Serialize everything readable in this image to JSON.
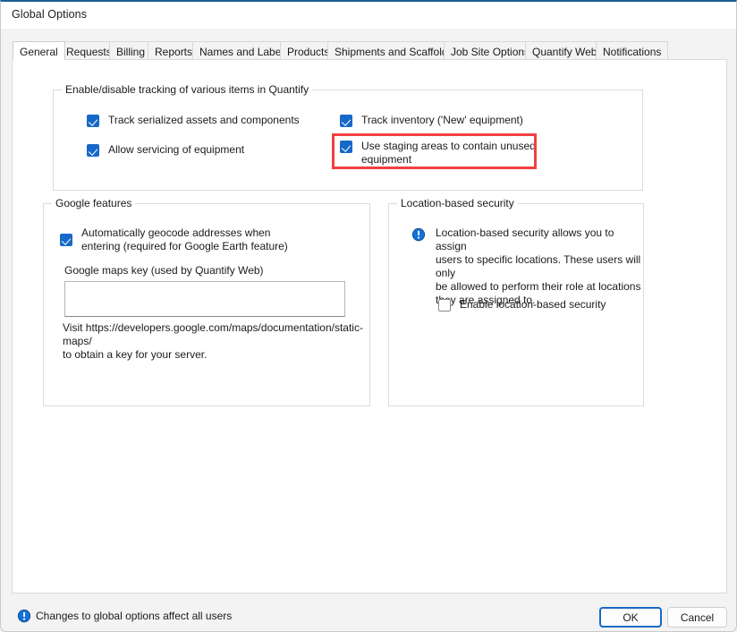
{
  "window": {
    "title": "Global Options"
  },
  "tabs": [
    {
      "label": "General",
      "selected": true
    },
    {
      "label": "Requests",
      "selected": false
    },
    {
      "label": "Billing",
      "selected": false
    },
    {
      "label": "Reports",
      "selected": false
    },
    {
      "label": "Names and Labels",
      "selected": false
    },
    {
      "label": "Products",
      "selected": false
    },
    {
      "label": "Shipments and Scaffolds",
      "selected": false
    },
    {
      "label": "Job Site Options",
      "selected": false
    },
    {
      "label": "Quantify Web",
      "selected": false
    },
    {
      "label": "Notifications",
      "selected": false
    }
  ],
  "tracking_group": {
    "title": "Enable/disable tracking of various items in Quantify",
    "checkboxes": [
      {
        "label": "Track serialized assets and components",
        "checked": true
      },
      {
        "label": "Allow servicing of equipment",
        "checked": true
      },
      {
        "label": "Track inventory ('New' equipment)",
        "checked": true
      },
      {
        "label": "Use staging areas to contain unused\nequipment",
        "checked": true,
        "highlighted": true
      }
    ]
  },
  "google_group": {
    "title": "Google features",
    "geocode_checkbox": {
      "label": "Automatically geocode addresses when\nentering (required for Google Earth feature)",
      "checked": true
    },
    "maps_key_label": "Google maps key (used by Quantify Web)",
    "maps_key_value": "",
    "maps_key_placeholder": "",
    "help_text": "Visit https://developers.google.com/maps/documentation/static-maps/\nto obtain a key for your server."
  },
  "location_group": {
    "title": "Location-based security",
    "info_icon": "info-exclamation-icon",
    "description": "Location-based security allows you to assign\nusers to specific locations. These users will only\nbe allowed to perform their role at locations\nthey are assigned to.",
    "enable_checkbox": {
      "label": "Enable location-based security",
      "checked": false
    }
  },
  "statusbar": {
    "info_icon": "info-exclamation-icon",
    "message": "Changes to global options affect all users"
  },
  "buttons": {
    "ok": "OK",
    "cancel": "Cancel"
  },
  "colors": {
    "accent": "#1769c9",
    "highlight": "#f2403f",
    "titlebar_top": "#1d5d96"
  }
}
